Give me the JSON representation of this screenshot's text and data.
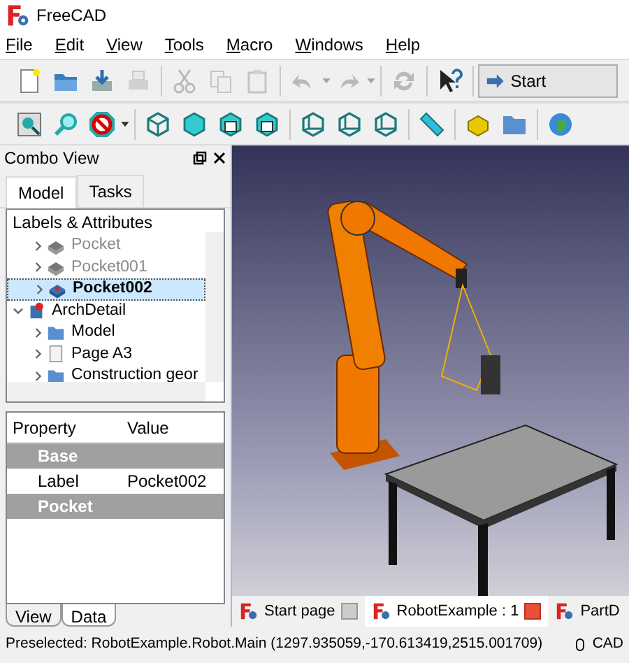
{
  "window": {
    "title": "FreeCAD"
  },
  "menu": [
    "File",
    "Edit",
    "View",
    "Tools",
    "Macro",
    "Windows",
    "Help"
  ],
  "toolbar_1": [
    {
      "kind": "new",
      "disabled": false
    },
    {
      "kind": "open",
      "disabled": false
    },
    {
      "kind": "save",
      "disabled": false
    },
    {
      "kind": "print",
      "disabled": true
    },
    {
      "kind": "sep"
    },
    {
      "kind": "cut",
      "disabled": true
    },
    {
      "kind": "copy",
      "disabled": true
    },
    {
      "kind": "paste",
      "disabled": true
    },
    {
      "kind": "sep"
    },
    {
      "kind": "undo",
      "disabled": true
    },
    {
      "kind": "redo",
      "disabled": true
    },
    {
      "kind": "sep"
    },
    {
      "kind": "refresh",
      "disabled": true
    },
    {
      "kind": "sep"
    },
    {
      "kind": "whatsthis",
      "disabled": false
    }
  ],
  "workbench": {
    "label": "Start"
  },
  "toolbar_2": [
    {
      "kind": "fitall"
    },
    {
      "kind": "fitsel"
    },
    {
      "kind": "drawstyle"
    },
    {
      "kind": "sep"
    },
    {
      "kind": "cube"
    },
    {
      "kind": "cubesolid"
    },
    {
      "kind": "cubeface"
    },
    {
      "kind": "cubeface"
    },
    {
      "kind": "sep"
    },
    {
      "kind": "cubewire"
    },
    {
      "kind": "cubewire"
    },
    {
      "kind": "cubewire"
    },
    {
      "kind": "sep"
    },
    {
      "kind": "measure"
    },
    {
      "kind": "sep"
    },
    {
      "kind": "part"
    },
    {
      "kind": "folder"
    },
    {
      "kind": "sep"
    },
    {
      "kind": "web"
    }
  ],
  "combo_view": {
    "title": "Combo View",
    "tabs": [
      {
        "label": "Model",
        "selected": true
      },
      {
        "label": "Tasks",
        "selected": false
      }
    ],
    "tree_header": "Labels & Attributes",
    "tree": [
      {
        "children": [
          {
            "label": "Pocket",
            "kind": "pocket",
            "visible": false,
            "selected": false,
            "expanded": false
          },
          {
            "label": "Pocket001",
            "kind": "pocket",
            "visible": false,
            "selected": false,
            "expanded": false
          },
          {
            "label": "Pocket002",
            "kind": "pocket",
            "visible": true,
            "selected": true,
            "expanded": false
          }
        ]
      },
      {
        "label": "ArchDetail",
        "kind": "arch",
        "visible": true,
        "selected": false,
        "expanded": true,
        "children": [
          {
            "label": "Model",
            "kind": "folder",
            "visible": true,
            "selected": false,
            "expanded": false
          },
          {
            "label": "Page A3",
            "kind": "page",
            "visible": true,
            "selected": false,
            "expanded": false
          },
          {
            "label": "Construction geor",
            "kind": "folder",
            "visible": true,
            "selected": false,
            "expanded": false
          }
        ]
      }
    ],
    "property_columns": [
      "Property",
      "Value"
    ],
    "properties": [
      {
        "kind": "group",
        "name": "Base"
      },
      {
        "kind": "property",
        "name": "Label",
        "value": "Pocket002"
      },
      {
        "kind": "group",
        "name": "Pocket"
      }
    ],
    "bottom_tabs": [
      {
        "label": "View",
        "selected": false
      },
      {
        "label": "Data",
        "selected": true
      }
    ]
  },
  "document_tabs": [
    {
      "label": "Start page",
      "selected": false
    },
    {
      "label": "RobotExample : 1",
      "selected": true
    },
    {
      "label": "PartD",
      "selected": false
    }
  ],
  "status_bar": {
    "message": "Preselected: RobotExample.Robot.Main (1297.935059,-170.613419,2515.001709)",
    "navigation": "CAD"
  }
}
